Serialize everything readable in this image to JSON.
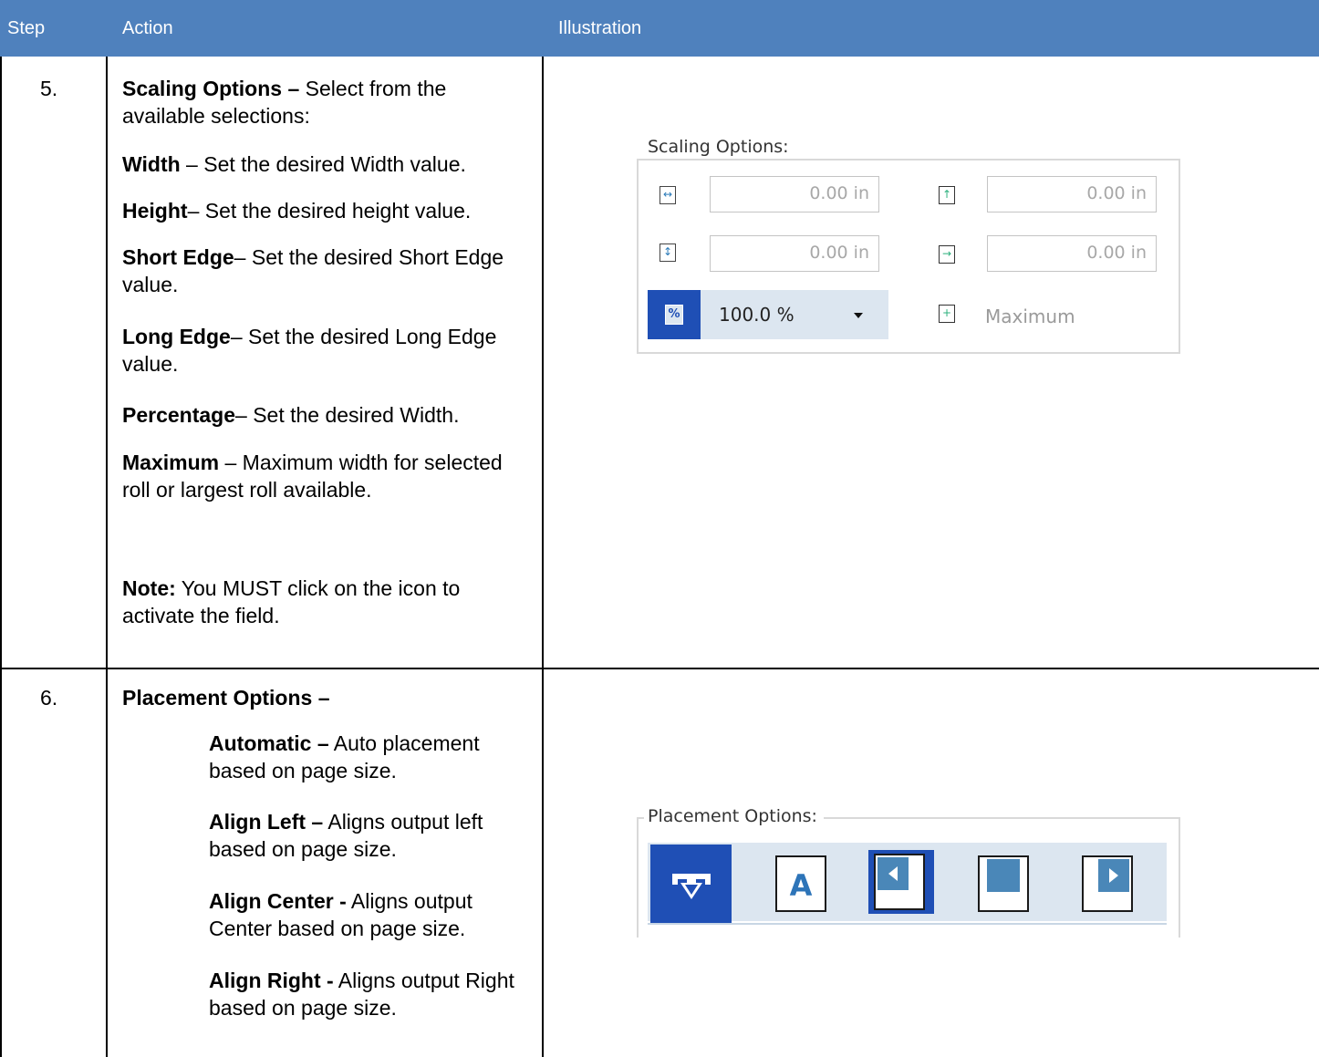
{
  "header": {
    "step": "Step",
    "action": "Action",
    "illustration": "Illustration"
  },
  "rows": [
    {
      "step": "5.",
      "items": [
        {
          "bold": "Scaling Options –",
          "text": " Select from the available selections:"
        },
        {
          "bold": "Width",
          "text": " – Set the desired Width value."
        },
        {
          "bold": "Height",
          "text": "– Set the desired height value."
        },
        {
          "bold": "Short Edge",
          "text": "– Set the desired Short Edge value."
        },
        {
          "bold": "Long Edge",
          "text": "– Set the desired Long Edge value."
        },
        {
          "bold": "Percentage",
          "text": "– Set the desired Width."
        },
        {
          "bold": "Maximum",
          "text": " – Maximum width for selected roll or largest roll available."
        },
        {
          "bold": "Note:",
          "text": " You MUST click on the icon to activate the field."
        }
      ]
    },
    {
      "step": "6.",
      "items": [
        {
          "bold": "Placement Options –",
          "text": ""
        },
        {
          "bold": "Automatic –",
          "text": " Auto placement based on page size."
        },
        {
          "bold": "Align Left –",
          "text": " Aligns output left based on page size."
        },
        {
          "bold": "Align Center -",
          "text": " Aligns output Center based on page size."
        },
        {
          "bold": "Align Right -",
          "text": " Aligns output Right based on page size."
        }
      ]
    }
  ],
  "scaling_panel": {
    "title": "Scaling Options:",
    "width_value": "0.00 in",
    "height_value": "0.00 in",
    "short_edge_value": "0.00 in",
    "long_edge_value": "0.00 in",
    "percentage_value": "100.0 %",
    "percent_icon": "%",
    "maximum_label": "Maximum"
  },
  "placement_panel": {
    "title": "Placement Options:",
    "text_icon": "A"
  },
  "colors": {
    "header_bg": "#4f81bd",
    "selected_blue": "#1f4fb5",
    "strip_bg": "#dce6f0"
  }
}
